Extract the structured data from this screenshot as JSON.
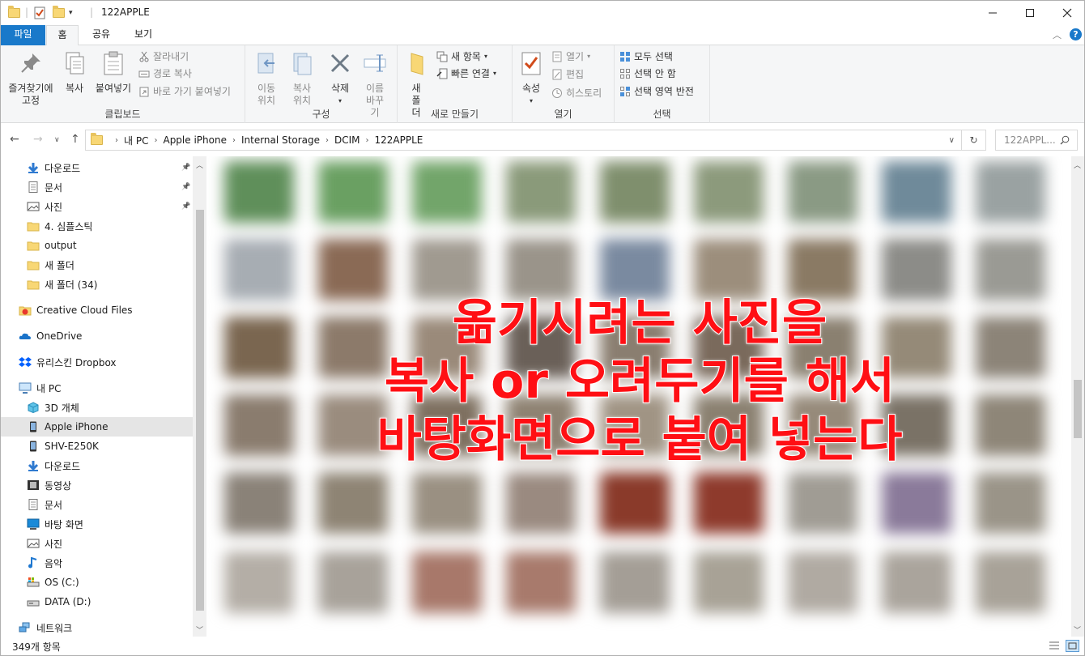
{
  "window": {
    "title": "122APPLE",
    "min_icon": "minimize-icon",
    "max_icon": "maximize-icon",
    "close_icon": "close-icon"
  },
  "ribbon_tabs": [
    "파일",
    "홈",
    "공유",
    "보기"
  ],
  "ribbon": {
    "clipboard": {
      "label": "클립보드",
      "pin": "즐겨찾기에 고정",
      "copy": "복사",
      "paste": "붙여넣기",
      "cut": "잘라내기",
      "copy_path": "경로 복사",
      "paste_shortcut": "바로 가기 붙여넣기"
    },
    "organize": {
      "label": "구성",
      "move_to": "이동 위치",
      "copy_to": "복사 위치",
      "delete": "삭제",
      "rename": "이름 바꾸기"
    },
    "new": {
      "label": "새로 만들기",
      "new_folder": "새 폴더",
      "new_item": "새 항목",
      "easy_access": "빠른 연결"
    },
    "open": {
      "label": "열기",
      "properties": "속성",
      "open": "열기",
      "edit": "편집",
      "history": "히스토리"
    },
    "select": {
      "label": "선택",
      "select_all": "모두 선택",
      "select_none": "선택 안 함",
      "invert": "선택 영역 반전"
    }
  },
  "address": {
    "crumbs": [
      "내 PC",
      "Apple iPhone",
      "Internal Storage",
      "DCIM",
      "122APPLE"
    ],
    "search_placeholder": "122APPL..."
  },
  "nav_items": [
    {
      "label": "다운로드",
      "icon": "download-arrow-icon",
      "pinned": true
    },
    {
      "label": "문서",
      "icon": "document-icon",
      "pinned": true
    },
    {
      "label": "사진",
      "icon": "pictures-icon",
      "pinned": true
    },
    {
      "label": "4. 심플스틱",
      "icon": "folder-icon"
    },
    {
      "label": "output",
      "icon": "folder-icon"
    },
    {
      "label": "새 폴더",
      "icon": "folder-icon"
    },
    {
      "label": "새 폴더 (34)",
      "icon": "folder-icon"
    },
    {
      "label": "Creative Cloud Files",
      "icon": "creative-cloud-icon"
    },
    {
      "label": "OneDrive",
      "icon": "onedrive-cloud-icon"
    },
    {
      "label": "유리스킨 Dropbox",
      "icon": "dropbox-icon"
    },
    {
      "label": "내 PC",
      "icon": "pc-monitor-icon"
    },
    {
      "label": "3D 개체",
      "icon": "3d-objects-icon"
    },
    {
      "label": "Apple iPhone",
      "icon": "phone-icon",
      "selected": true
    },
    {
      "label": "SHV-E250K",
      "icon": "phone-icon"
    },
    {
      "label": "다운로드",
      "icon": "download-arrow-icon"
    },
    {
      "label": "동영상",
      "icon": "video-icon"
    },
    {
      "label": "문서",
      "icon": "document-icon"
    },
    {
      "label": "바탕 화면",
      "icon": "desktop-icon"
    },
    {
      "label": "사진",
      "icon": "pictures-icon"
    },
    {
      "label": "음악",
      "icon": "music-note-icon"
    },
    {
      "label": "OS (C:)",
      "icon": "os-drive-icon"
    },
    {
      "label": "DATA (D:)",
      "icon": "drive-icon"
    },
    {
      "label": "네트워크",
      "icon": "network-icon"
    }
  ],
  "overlay": {
    "line1": "옮기시려는 사진을",
    "line2": "복사 or 오려두기를 해서",
    "line3": "바탕화면으로 붙여 넣는다",
    "color": "#ff0f14"
  },
  "status": {
    "count": "349개 항목"
  },
  "colors": {
    "accent": "#1979ca",
    "selection": "#e5e5e5"
  }
}
